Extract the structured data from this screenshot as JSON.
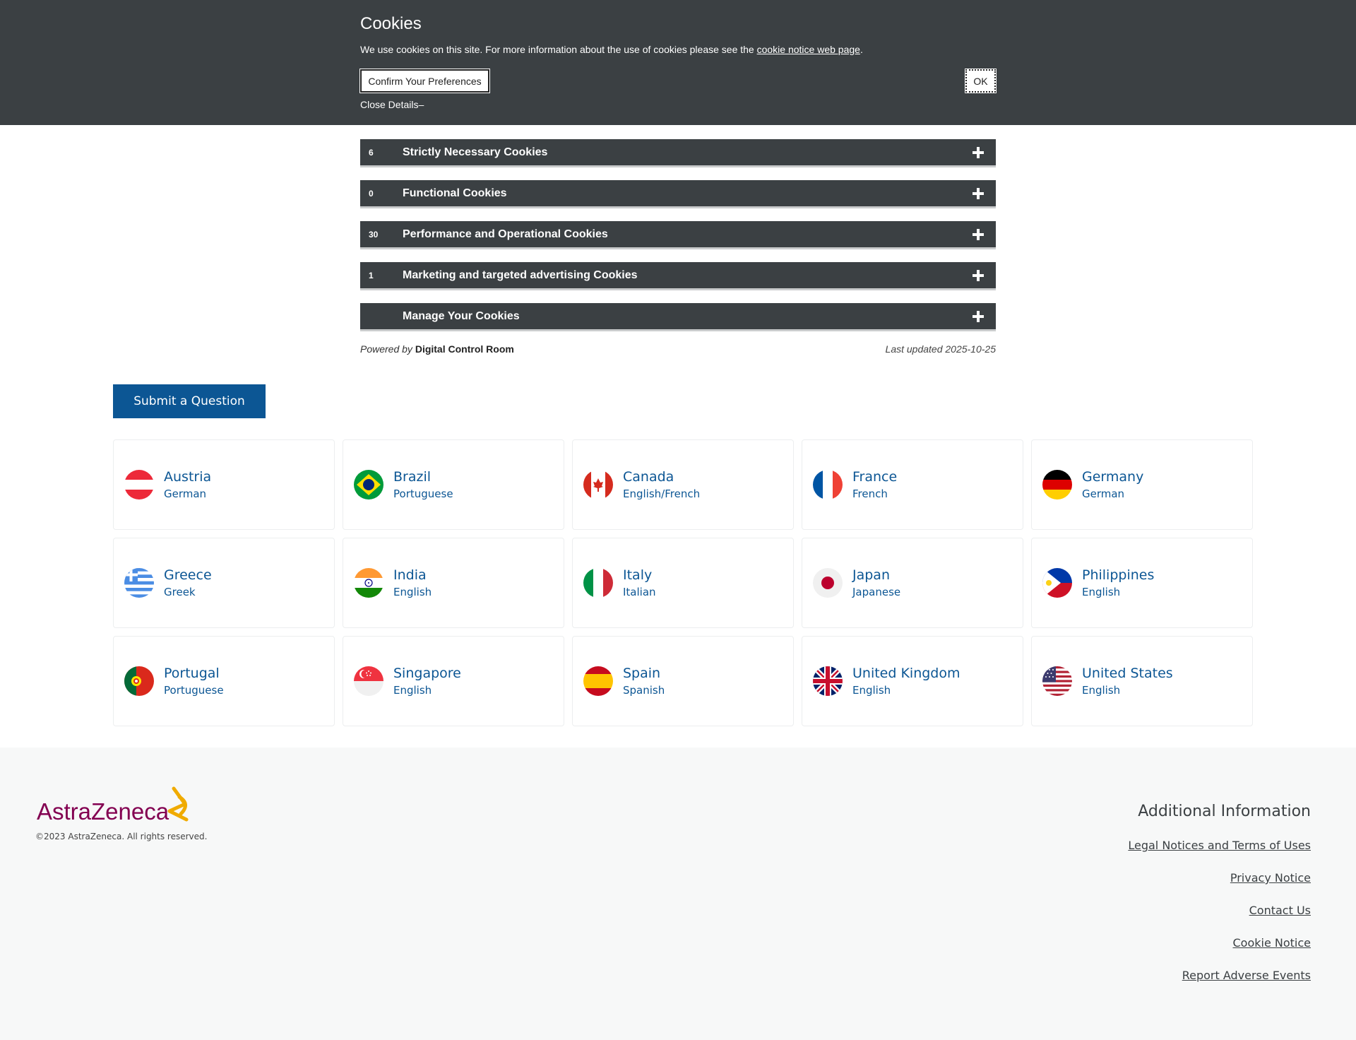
{
  "cookie_banner": {
    "title": "Cookies",
    "text_before": "We use cookies on this site. For more information about the use of cookies please see the ",
    "link_text": "cookie notice web page",
    "text_after": ".",
    "confirm_label": "Confirm Your Preferences",
    "ok_label": "OK",
    "close_details": "Close Details–"
  },
  "categories": [
    {
      "count": "6",
      "label": "Strictly Necessary Cookies"
    },
    {
      "count": "0",
      "label": "Functional Cookies"
    },
    {
      "count": "30",
      "label": "Performance and Operational Cookies"
    },
    {
      "count": "1",
      "label": "Marketing and targeted advertising Cookies"
    },
    {
      "count": "",
      "label": "Manage Your Cookies"
    }
  ],
  "powered_by": {
    "prefix": "Powered by ",
    "name": "Digital Control Room"
  },
  "last_updated": "Last updated 2025-10-25",
  "submit_question": "Submit a Question",
  "countries": [
    {
      "name": "Austria",
      "language": "German",
      "flag": "austria-flag-icon"
    },
    {
      "name": "Brazil",
      "language": "Portuguese",
      "flag": "brazil-flag-icon"
    },
    {
      "name": "Canada",
      "language": "English/French",
      "flag": "canada-flag-icon"
    },
    {
      "name": "France",
      "language": "French",
      "flag": "france-flag-icon"
    },
    {
      "name": "Germany",
      "language": "German",
      "flag": "germany-flag-icon"
    },
    {
      "name": "Greece",
      "language": "Greek",
      "flag": "greece-flag-icon"
    },
    {
      "name": "India",
      "language": "English",
      "flag": "india-flag-icon"
    },
    {
      "name": "Italy",
      "language": "Italian",
      "flag": "italy-flag-icon"
    },
    {
      "name": "Japan",
      "language": "Japanese",
      "flag": "japan-flag-icon"
    },
    {
      "name": "Philippines",
      "language": "English",
      "flag": "philippines-flag-icon"
    },
    {
      "name": "Portugal",
      "language": "Portuguese",
      "flag": "portugal-flag-icon"
    },
    {
      "name": "Singapore",
      "language": "English",
      "flag": "singapore-flag-icon"
    },
    {
      "name": "Spain",
      "language": "Spanish",
      "flag": "spain-flag-icon"
    },
    {
      "name": "United Kingdom",
      "language": "English",
      "flag": "uk-flag-icon"
    },
    {
      "name": "United States",
      "language": "English",
      "flag": "us-flag-icon"
    }
  ],
  "footer": {
    "logo_text": "AstraZeneca",
    "copyright": "©2023 AstraZeneca. All rights reserved.",
    "additional_title": "Additional Information",
    "links": [
      "Legal Notices and Terms of Uses",
      "Privacy Notice",
      "Contact Us",
      "Cookie Notice",
      "Report Adverse Events"
    ]
  },
  "colors": {
    "banner_bg": "#3b4043",
    "brand_blue": "#0c5694",
    "logo_purple": "#830051",
    "logo_gold": "#f0ab00",
    "footer_bg": "#f7f8f8"
  }
}
